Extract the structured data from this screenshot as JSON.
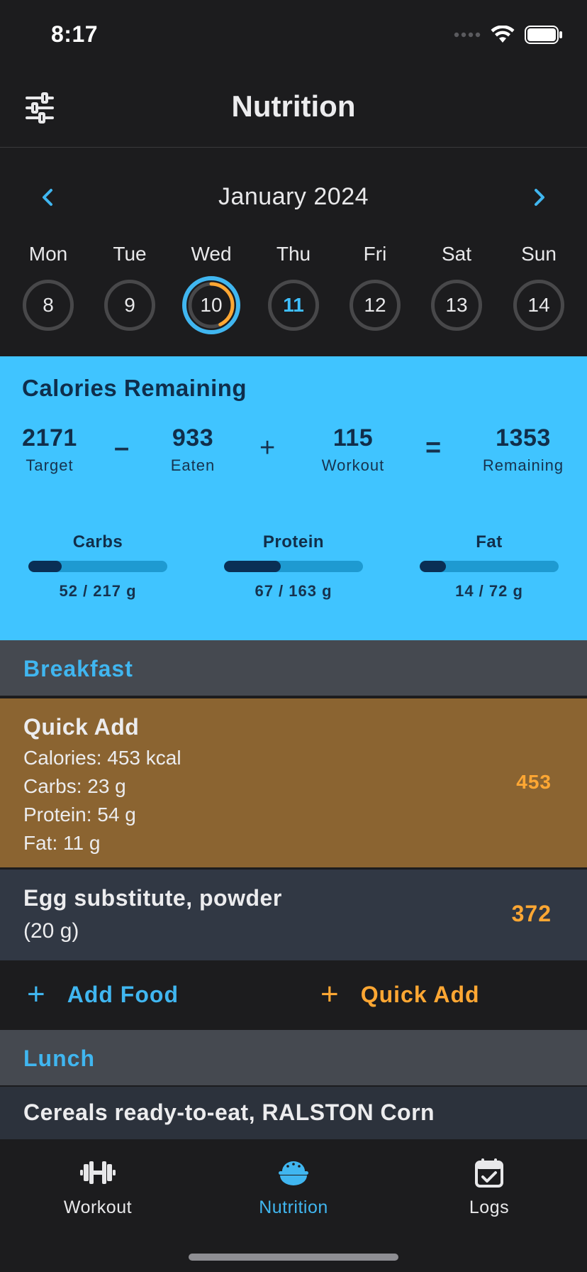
{
  "status_bar": {
    "time": "8:17"
  },
  "header": {
    "title": "Nutrition"
  },
  "calendar": {
    "month": "January 2024",
    "days": [
      {
        "name": "Mon",
        "date": "8"
      },
      {
        "name": "Tue",
        "date": "9"
      },
      {
        "name": "Wed",
        "date": "10"
      },
      {
        "name": "Thu",
        "date": "11"
      },
      {
        "name": "Fri",
        "date": "12"
      },
      {
        "name": "Sat",
        "date": "13"
      },
      {
        "name": "Sun",
        "date": "14"
      }
    ],
    "selected_day": "10",
    "today": "11",
    "selected_day_progress": 0.43
  },
  "summary": {
    "title": "Calories Remaining",
    "target": {
      "value": "2171",
      "label": "Target"
    },
    "eaten": {
      "value": "933",
      "label": "Eaten"
    },
    "workout": {
      "value": "115",
      "label": "Workout"
    },
    "remaining": {
      "value": "1353",
      "label": "Remaining"
    },
    "op_minus": "–",
    "op_plus": "+",
    "op_equals": "=",
    "macros": [
      {
        "name": "Carbs",
        "text": "52 / 217 g",
        "progress": 0.24
      },
      {
        "name": "Protein",
        "text": "67 / 163 g",
        "progress": 0.41
      },
      {
        "name": "Fat",
        "text": "14 / 72 g",
        "progress": 0.19
      }
    ]
  },
  "meals": {
    "breakfast": {
      "title": "Breakfast",
      "quick_add": {
        "title": "Quick Add",
        "calories_line": "Calories: 453 kcal",
        "carbs_line": "Carbs: 23 g",
        "protein_line": "Protein: 54 g",
        "fat_line": "Fat: 11 g",
        "calories": "453"
      },
      "egg": {
        "title": "Egg substitute, powder",
        "amount": "(20 g)",
        "calories": "372"
      },
      "add_food_label": "Add Food",
      "quick_add_label": "Quick Add"
    },
    "lunch": {
      "title": "Lunch",
      "cereal": {
        "title": "Cereals ready-to-eat, RALSTON Corn"
      }
    }
  },
  "tabbar": {
    "tabs": [
      {
        "label": "Workout",
        "icon": "dumbbell-icon"
      },
      {
        "label": "Nutrition",
        "icon": "food-bowl-icon"
      },
      {
        "label": "Logs",
        "icon": "calendar-check-icon"
      }
    ],
    "active": "Nutrition"
  },
  "colors": {
    "accent_blue": "#40c4ff",
    "orange": "#ffa733",
    "quick_add_bg": "#8b6431"
  }
}
